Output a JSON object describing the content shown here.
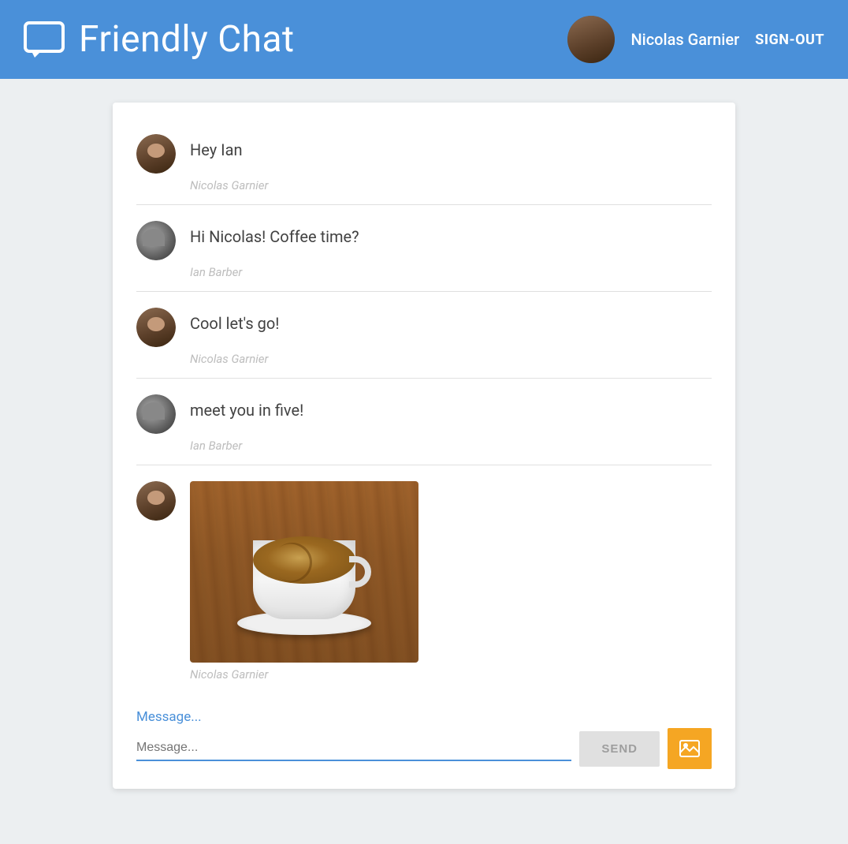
{
  "header": {
    "title": "Friendly Chat",
    "username": "Nicolas Garnier",
    "signout_label": "SIGN-OUT"
  },
  "messages": [
    {
      "id": 1,
      "text": "Hey Ian",
      "author": "Nicolas Garnier",
      "avatar_type": "nicolas"
    },
    {
      "id": 2,
      "text": "Hi Nicolas! Coffee time?",
      "author": "Ian Barber",
      "avatar_type": "ian"
    },
    {
      "id": 3,
      "text": "Cool let's go!",
      "author": "Nicolas Garnier",
      "avatar_type": "nicolas"
    },
    {
      "id": 4,
      "text": "meet you in five!",
      "author": "Ian Barber",
      "avatar_type": "ian"
    },
    {
      "id": 5,
      "text": "",
      "author": "Nicolas Garnier",
      "avatar_type": "nicolas",
      "is_image": true
    }
  ],
  "input": {
    "placeholder": "Message...",
    "send_label": "SEND"
  }
}
